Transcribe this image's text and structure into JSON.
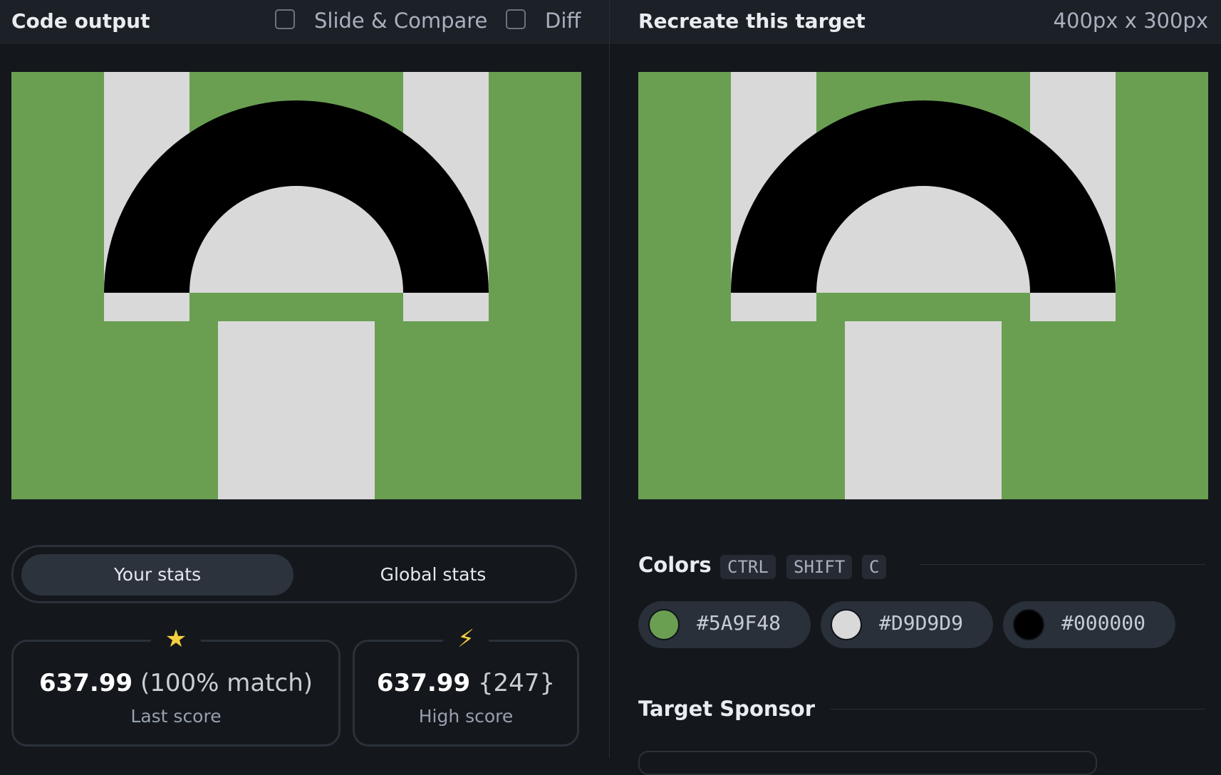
{
  "left": {
    "title": "Code output",
    "slide_compare_label": "Slide & Compare",
    "diff_label": "Diff"
  },
  "right": {
    "title": "Recreate this target",
    "dimensions": "400px x 300px"
  },
  "stats": {
    "tab_your": "Your stats",
    "tab_global": "Global stats",
    "last_score_value": "637.99",
    "last_score_match": "(100% match)",
    "last_score_label": "Last score",
    "high_score_value": "637.99",
    "high_score_rank": "{247}",
    "high_score_label": "High score",
    "star_icon": "★",
    "bolt_icon": "⚡"
  },
  "colors_section": {
    "title": "Colors",
    "shortcut_keys": [
      "CTRL",
      "SHIFT",
      "C"
    ],
    "swatches": [
      {
        "hex": "#5A9F48",
        "color": "#6a9f51"
      },
      {
        "hex": "#D9D9D9",
        "color": "#d9d9d9"
      },
      {
        "hex": "#000000",
        "color": "#000000"
      }
    ]
  },
  "sponsor_section": {
    "title": "Target Sponsor"
  }
}
